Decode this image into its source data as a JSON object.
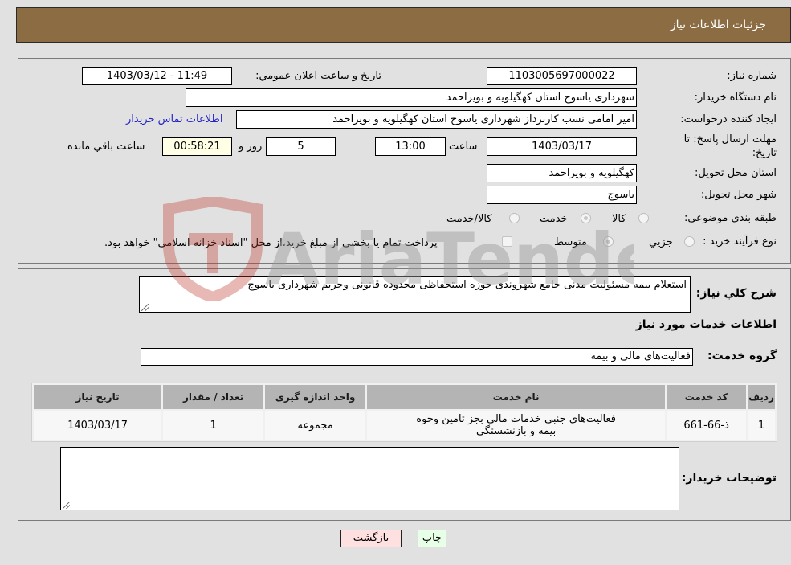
{
  "header": {
    "title": "جزئیات اطلاعات نیاز"
  },
  "form": {
    "need_number": {
      "label": "شماره نیاز:",
      "value": "1103005697000022"
    },
    "announce_datetime": {
      "label": "تاریخ و ساعت اعلان عمومي:",
      "value": "1403/03/12 - 11:49"
    },
    "buyer_org": {
      "label": "نام دستگاه خریدار:",
      "value": "شهرداری یاسوج استان کهگیلویه و بویراحمد"
    },
    "requester": {
      "label": "ایجاد کننده درخواست:",
      "value": "امیر امامی نسب کاربرداز شهرداری یاسوج استان کهگیلویه و بویراحمد"
    },
    "buyer_contact_link": "اطلاعات تماس خریدار",
    "deadline": {
      "label": "مهلت ارسال پاسخ: تا تاریخ:",
      "date": "1403/03/17",
      "time_label": "ساعت",
      "time": "13:00",
      "days": "5",
      "days_label": "روز و",
      "remaining": "00:58:21",
      "remaining_label": "ساعت باقي مانده"
    },
    "delivery_province": {
      "label": "استان محل تحویل:",
      "value": "کهگیلویه و بویراحمد"
    },
    "delivery_city": {
      "label": "شهر محل تحویل:",
      "value": "یاسوج"
    },
    "category": {
      "label": "طبقه بندی موضوعی:",
      "options": [
        "کالا",
        "خدمت",
        "کالا/خدمت"
      ],
      "selected": "خدمت"
    },
    "purchase_type": {
      "label": "نوع فرآیند خرید :",
      "options": [
        "جزيي",
        "متوسط"
      ],
      "selected": "متوسط",
      "treasury_note": "پرداخت تمام یا بخشی از مبلغ خرید،از محل \"اسناد خزانه اسلامی\" خواهد بود.",
      "treasury_checked": false
    }
  },
  "details": {
    "description_label": "شرح کلي نیاز:",
    "description": "استعلام بیمه مسئولیت مدنی جامع شهروندی حوزه استحفاظی محدوده قانونی وحریم شهرداری یاسوج",
    "services_heading": "اطلاعات خدمات مورد نیاز",
    "service_group_label": "گروه خدمت:",
    "service_group": "فعالیت‌های مالی و بیمه",
    "table": {
      "headers": [
        "ردیف",
        "کد خدمت",
        "نام خدمت",
        "واحد اندازه گیری",
        "تعداد / مقدار",
        "تاریخ نیاز"
      ],
      "rows": [
        [
          "1",
          "ذ-66-661",
          "فعالیت‌های جنبی خدمات مالی بجز تامین وجوه بیمه و بازنشستگی",
          "مجموعه",
          "1",
          "1403/03/17"
        ]
      ]
    },
    "buyer_notes_label": "توضیحات خریدار:",
    "buyer_notes": ""
  },
  "buttons": {
    "print": "چاپ",
    "back": "بازگشت"
  },
  "colors": {
    "header_bg": "#8b6c43",
    "print_bg": "#e6ffe6",
    "back_bg": "#ffe0e0",
    "link": "#2323c8"
  },
  "watermark": {
    "text": "AriaTender.neT"
  }
}
